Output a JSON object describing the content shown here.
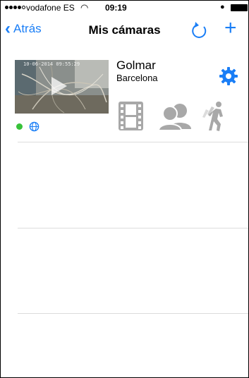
{
  "status_bar": {
    "carrier": "vodafone ES",
    "time": "09:19"
  },
  "nav": {
    "back_label": "Atrás",
    "title": "Mis cámaras"
  },
  "cameras": [
    {
      "name": "Golmar",
      "location": "Barcelona",
      "timestamp": "10-06-2014 09:55:29",
      "online": true
    }
  ],
  "colors": {
    "accent": "#1a7ef6",
    "online": "#38c23a",
    "feature_icon": "#a8a8a8"
  },
  "icons": [
    "back-chevron-icon",
    "refresh-icon",
    "add-icon",
    "play-icon",
    "globe-icon",
    "gear-icon",
    "film-icon",
    "users-icon",
    "motion-icon"
  ]
}
